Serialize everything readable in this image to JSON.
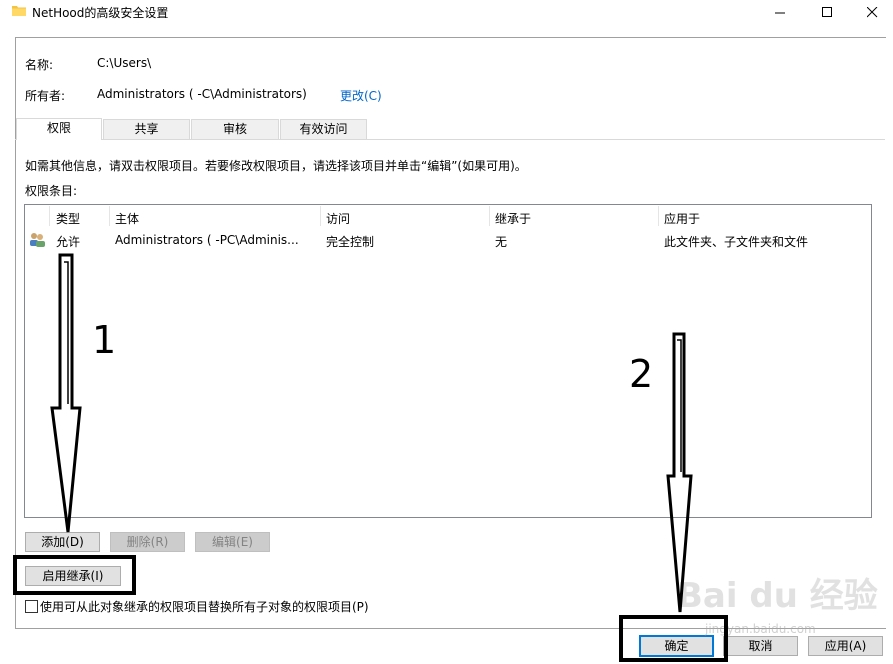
{
  "window": {
    "title": "NetHood的高级安全设置",
    "minimize_glyph": "—",
    "maximize_glyph": "☐",
    "close_glyph": "✕"
  },
  "header": {
    "name_label": "名称:",
    "name_value": "C:\\Users\\      ",
    "owner_label": "所有者:",
    "owner_value": "Administrators (          -C\\Administrators)",
    "change_link": "更改(C)"
  },
  "tabs": [
    {
      "label": "权限",
      "active": true
    },
    {
      "label": "共享",
      "active": false
    },
    {
      "label": "审核",
      "active": false
    },
    {
      "label": "有效访问",
      "active": false
    }
  ],
  "info_text": "如需其他信息，请双击权限项目。若要修改权限项目，请选择该项目并单击“编辑”(如果可用)。",
  "list_label": "权限条目:",
  "columns": [
    "类型",
    "主体",
    "访问",
    "继承于",
    "应用于"
  ],
  "rows": [
    {
      "icon": "users-icon",
      "type": "允许",
      "principal": "Administrators (          -PC\\Adminis...",
      "access": "完全控制",
      "inherited_from": "无",
      "applies_to": "此文件夹、子文件夹和文件"
    }
  ],
  "buttons": {
    "add": "添加(D)",
    "remove": "删除(R)",
    "edit": "编辑(E)",
    "enable_inheritance": "启用继承(I)",
    "ok": "确定",
    "cancel": "取消",
    "apply": "应用(A)"
  },
  "checkbox": {
    "label": "使用可从此对象继承的权限项目替换所有子对象的权限项目(P)",
    "checked": false
  },
  "annotations": {
    "step1": "1",
    "step2": "2"
  },
  "watermark": {
    "brand": "Bai du 经验",
    "url": "jingyan.baidu.com"
  },
  "colors": {
    "link": "#0066cc",
    "default_button_border": "#0078d7",
    "highlight": "#000000"
  }
}
